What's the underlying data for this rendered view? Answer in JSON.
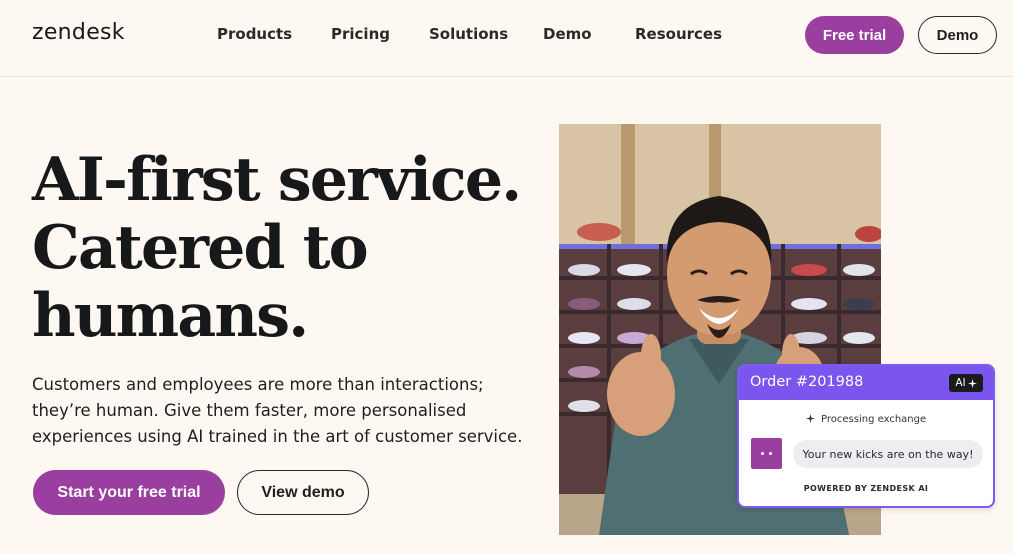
{
  "header": {
    "logo": "zendesk",
    "nav": [
      "Products",
      "Pricing",
      "Solutions",
      "Demo",
      "Resources"
    ],
    "free_trial_label": "Free trial",
    "demo_label": "Demo"
  },
  "hero": {
    "title_lines": [
      "AI-first service.",
      "Catered to",
      "humans."
    ],
    "body_lines": [
      "Customers and employees are more than interactions;",
      "they’re human. Give them faster, more personalised",
      "experiences using AI trained in the art of customer service."
    ],
    "cta_primary": "Start your free trial",
    "cta_secondary": "View demo"
  },
  "ai_card": {
    "order": "Order #201988",
    "badge": "AI",
    "status": "Processing exchange",
    "message": "Your new kicks are on the way!",
    "powered": "POWERED BY ZENDESK AI"
  },
  "colors": {
    "brand_purple": "#9a3f9f",
    "card_purple": "#7a55ee",
    "background": "#fdf8f1"
  }
}
